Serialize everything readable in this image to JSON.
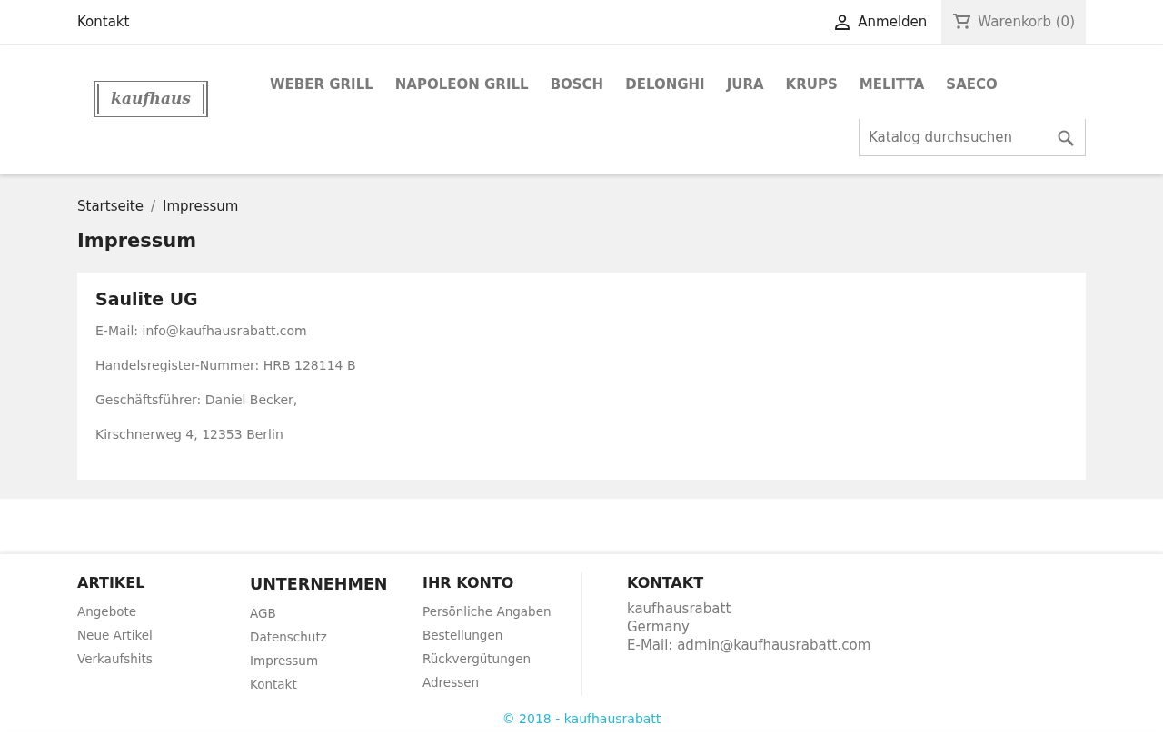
{
  "topbar": {
    "contact": "Kontakt",
    "login": "Anmelden",
    "cart": "Warenkorb (0)"
  },
  "logo": {
    "text": "kaufhaus"
  },
  "menu": [
    "WEBER GRILL",
    "NAPOLEON GRILL",
    "BOSCH",
    "DELONGHI",
    "JURA",
    "KRUPS",
    "MELITTA",
    "SAECO"
  ],
  "search": {
    "placeholder": "Katalog durchsuchen"
  },
  "breadcrumb": [
    "Startseite",
    "Impressum"
  ],
  "breadcrumb_separator": "/",
  "page_title": "Impressum",
  "content": {
    "heading": "Saulite UG",
    "lines": [
      "E-Mail: info@kaufhausrabatt.com",
      "Handelsregister-Nummer: HRB 128114 B",
      "Geschäftsführer: Daniel Becker,",
      "Kirschnerweg 4, 12353 Berlin"
    ]
  },
  "footer": {
    "columns": [
      {
        "title": "ARTIKEL",
        "links": [
          "Angebote",
          "Neue Artikel",
          "Verkaufshits"
        ]
      },
      {
        "title": "UNTERNEHMEN",
        "links": [
          "AGB",
          "Datenschutz",
          "Impressum",
          "Kontakt"
        ]
      },
      {
        "title": "IHR KONTO",
        "links": [
          "Persönliche Angaben",
          "Bestellungen",
          "Rückvergütungen",
          "Adressen"
        ]
      }
    ],
    "contact": {
      "title": "KONTAKT",
      "lines": [
        "kaufhausrabatt",
        "Germany",
        "E-Mail: admin@kaufhausrabatt.com"
      ]
    },
    "copyright": "© 2018 - kaufhausrabatt"
  }
}
